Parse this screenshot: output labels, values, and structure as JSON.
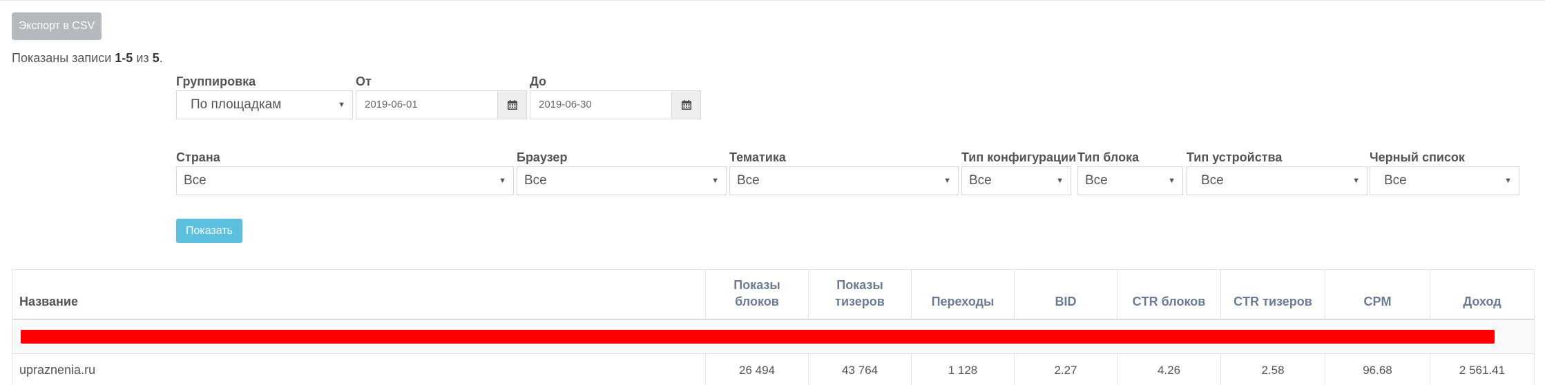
{
  "toolbar": {
    "export_label": "Экспорт в CSV"
  },
  "summary": {
    "prefix": "Показаны записи ",
    "range": "1-5",
    "middle": " из ",
    "total": "5",
    "suffix": "."
  },
  "filters": {
    "grouping": {
      "label": "Группировка",
      "value": "По площадкам"
    },
    "date_from": {
      "label": "От",
      "value": "2019-06-01"
    },
    "date_to": {
      "label": "До",
      "value": "2019-06-30"
    },
    "country": {
      "label": "Страна",
      "value": "Все"
    },
    "browser": {
      "label": "Браузер",
      "value": "Все"
    },
    "topic": {
      "label": "Тематика",
      "value": "Все"
    },
    "config_type": {
      "label": "Тип конфигурации",
      "value": "Все"
    },
    "block_type": {
      "label": "Тип блока",
      "value": "Все"
    },
    "device_type": {
      "label": "Тип устройства",
      "value": "Все"
    },
    "blacklist": {
      "label": "Черный список",
      "value": "Все"
    },
    "show_label": "Показать"
  },
  "table": {
    "columns": {
      "name": "Название",
      "block_impressions_1": "Показы",
      "block_impressions_2": "блоков",
      "teaser_impressions_1": "Показы",
      "teaser_impressions_2": "тизеров",
      "clicks": "Переходы",
      "bid": "BID",
      "ctr_blocks": "CTR блоков",
      "ctr_teasers": "CTR тизеров",
      "cpm": "CPM",
      "income": "Доход"
    },
    "rows": [
      {
        "name": "upraznenia.ru",
        "block_impressions": "26 494",
        "teaser_impressions": "43 764",
        "clicks": "1 128",
        "bid": "2.27",
        "ctr_blocks": "4.26",
        "ctr_teasers": "2.58",
        "cpm": "96.68",
        "income": "2 561.41"
      }
    ]
  },
  "colors": {
    "redacted_bar": "#ff0000",
    "primary_button": "#5bc0de",
    "disabled_button": "#b5b9bd",
    "header_link": "#6b7b95"
  },
  "icons": {
    "calendar": "calendar-icon",
    "dropdown": "caret-down-icon"
  }
}
